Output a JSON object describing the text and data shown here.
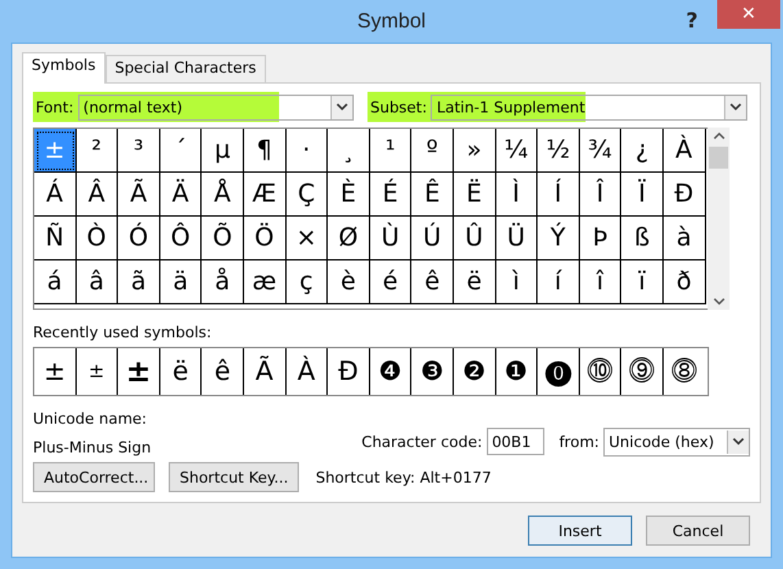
{
  "window": {
    "title": "Symbol",
    "help": "?",
    "close": "✕"
  },
  "tabs": [
    {
      "label": "Symbols",
      "selected": true
    },
    {
      "label": "Special Characters",
      "selected": false
    }
  ],
  "font": {
    "label": "Font:",
    "value": "(normal text)",
    "highlighted": true
  },
  "subset": {
    "label": "Subset:",
    "value": "Latin-1 Supplement",
    "highlighted": true
  },
  "symbols": [
    [
      {
        "char": "±",
        "selected": true
      },
      {
        "char": "²",
        "selected": false
      },
      {
        "char": "³",
        "selected": false
      },
      {
        "char": "´",
        "selected": false
      },
      {
        "char": "µ",
        "selected": false
      },
      {
        "char": "¶",
        "selected": false
      },
      {
        "char": "·",
        "selected": false
      },
      {
        "char": "¸",
        "selected": false
      },
      {
        "char": "¹",
        "selected": false
      },
      {
        "char": "º",
        "selected": false
      },
      {
        "char": "»",
        "selected": false
      },
      {
        "char": "¼",
        "selected": false
      },
      {
        "char": "½",
        "selected": false
      },
      {
        "char": "¾",
        "selected": false
      },
      {
        "char": "¿",
        "selected": false
      },
      {
        "char": "À",
        "selected": false
      }
    ],
    [
      {
        "char": "Á",
        "selected": false
      },
      {
        "char": "Â",
        "selected": false
      },
      {
        "char": "Ã",
        "selected": false
      },
      {
        "char": "Ä",
        "selected": false
      },
      {
        "char": "Å",
        "selected": false
      },
      {
        "char": "Æ",
        "selected": false
      },
      {
        "char": "Ç",
        "selected": false
      },
      {
        "char": "È",
        "selected": false
      },
      {
        "char": "É",
        "selected": false
      },
      {
        "char": "Ê",
        "selected": false
      },
      {
        "char": "Ë",
        "selected": false
      },
      {
        "char": "Ì",
        "selected": false
      },
      {
        "char": "Í",
        "selected": false
      },
      {
        "char": "Î",
        "selected": false
      },
      {
        "char": "Ï",
        "selected": false
      },
      {
        "char": "Ð",
        "selected": false
      }
    ],
    [
      {
        "char": "Ñ",
        "selected": false
      },
      {
        "char": "Ò",
        "selected": false
      },
      {
        "char": "Ó",
        "selected": false
      },
      {
        "char": "Ô",
        "selected": false
      },
      {
        "char": "Õ",
        "selected": false
      },
      {
        "char": "Ö",
        "selected": false
      },
      {
        "char": "×",
        "selected": false
      },
      {
        "char": "Ø",
        "selected": false
      },
      {
        "char": "Ù",
        "selected": false
      },
      {
        "char": "Ú",
        "selected": false
      },
      {
        "char": "Û",
        "selected": false
      },
      {
        "char": "Ü",
        "selected": false
      },
      {
        "char": "Ý",
        "selected": false
      },
      {
        "char": "Þ",
        "selected": false
      },
      {
        "char": "ß",
        "selected": false
      },
      {
        "char": "à",
        "selected": false
      }
    ],
    [
      {
        "char": "á",
        "selected": false
      },
      {
        "char": "â",
        "selected": false
      },
      {
        "char": "ã",
        "selected": false
      },
      {
        "char": "ä",
        "selected": false
      },
      {
        "char": "å",
        "selected": false
      },
      {
        "char": "æ",
        "selected": false
      },
      {
        "char": "ç",
        "selected": false
      },
      {
        "char": "è",
        "selected": false
      },
      {
        "char": "é",
        "selected": false
      },
      {
        "char": "ê",
        "selected": false
      },
      {
        "char": "ë",
        "selected": false
      },
      {
        "char": "ì",
        "selected": false
      },
      {
        "char": "í",
        "selected": false
      },
      {
        "char": "î",
        "selected": false
      },
      {
        "char": "ï",
        "selected": false
      },
      {
        "char": "ð",
        "selected": false
      }
    ]
  ],
  "recent": {
    "label": "Recently used symbols:",
    "symbols": [
      {
        "char": "±",
        "kind": "plain"
      },
      {
        "char": "±",
        "kind": "small"
      },
      {
        "char": "±",
        "kind": "heavy"
      },
      {
        "char": "ë",
        "kind": "plain"
      },
      {
        "char": "ê",
        "kind": "plain"
      },
      {
        "char": "Ã",
        "kind": "plain"
      },
      {
        "char": "À",
        "kind": "plain"
      },
      {
        "char": "Đ",
        "kind": "plain"
      },
      {
        "char": "❹",
        "kind": "plain"
      },
      {
        "char": "❸",
        "kind": "plain"
      },
      {
        "char": "❷",
        "kind": "plain"
      },
      {
        "char": "❶",
        "kind": "plain"
      },
      {
        "char": "⓿",
        "kind": "plain"
      },
      {
        "char": "⓾",
        "kind": "plain"
      },
      {
        "char": "⓽",
        "kind": "plain"
      },
      {
        "char": "⓼",
        "kind": "plain"
      }
    ]
  },
  "unicode_name": {
    "label": "Unicode name:",
    "value": "Plus-Minus Sign"
  },
  "character_code": {
    "label": "Character code:",
    "value": "00B1"
  },
  "from": {
    "label": "from:",
    "value": "Unicode (hex)"
  },
  "buttons": [
    {
      "label": "AutoCorrect..."
    },
    {
      "label": "Shortcut Key..."
    }
  ],
  "shortcut": "Shortcut key: Alt+0177",
  "footer_buttons": [
    {
      "label": "Insert",
      "default": true
    },
    {
      "label": "Cancel",
      "default": false
    }
  ]
}
